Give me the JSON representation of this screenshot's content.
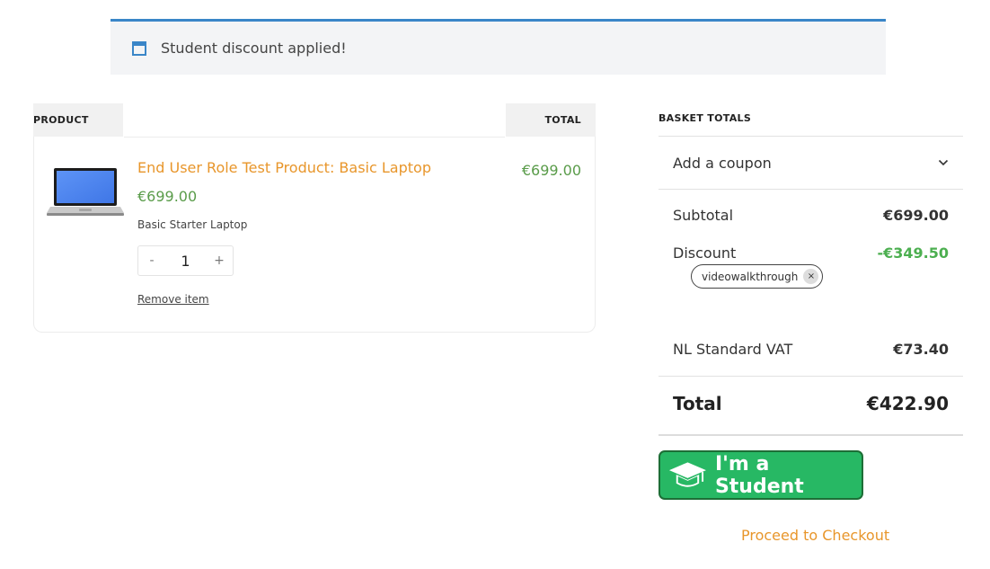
{
  "notice": {
    "text": "Student discount applied!",
    "icon": "window-icon"
  },
  "cart": {
    "headers": {
      "product": "PRODUCT",
      "total": "TOTAL"
    },
    "item": {
      "name": "End User Role Test Product: Basic Laptop",
      "price": "€699.00",
      "description": "Basic Starter Laptop",
      "quantity": "1",
      "minus": "-",
      "plus": "+",
      "remove": "Remove item",
      "line_total": "€699.00",
      "image": "laptop-image"
    }
  },
  "totals": {
    "title": "BASKET TOTALS",
    "coupon_label": "Add a coupon",
    "subtotal_label": "Subtotal",
    "subtotal_value": "€699.00",
    "discount_label": "Discount",
    "discount_value": "-€349.50",
    "coupon_code": "videowalkthrough",
    "coupon_remove": "×",
    "vat_label": "NL Standard VAT",
    "vat_value": "€73.40",
    "total_label": "Total",
    "total_value": "€422.90"
  },
  "student_button": {
    "label": "I'm a Student",
    "icon": "graduation-cap-icon"
  },
  "checkout": {
    "label": "Proceed to Checkout"
  },
  "colors": {
    "accent_blue": "#3a86c8",
    "link_orange": "#e8962b",
    "price_green": "#5a9c4a",
    "discount_green": "#4caf50",
    "student_green": "#27b864"
  }
}
